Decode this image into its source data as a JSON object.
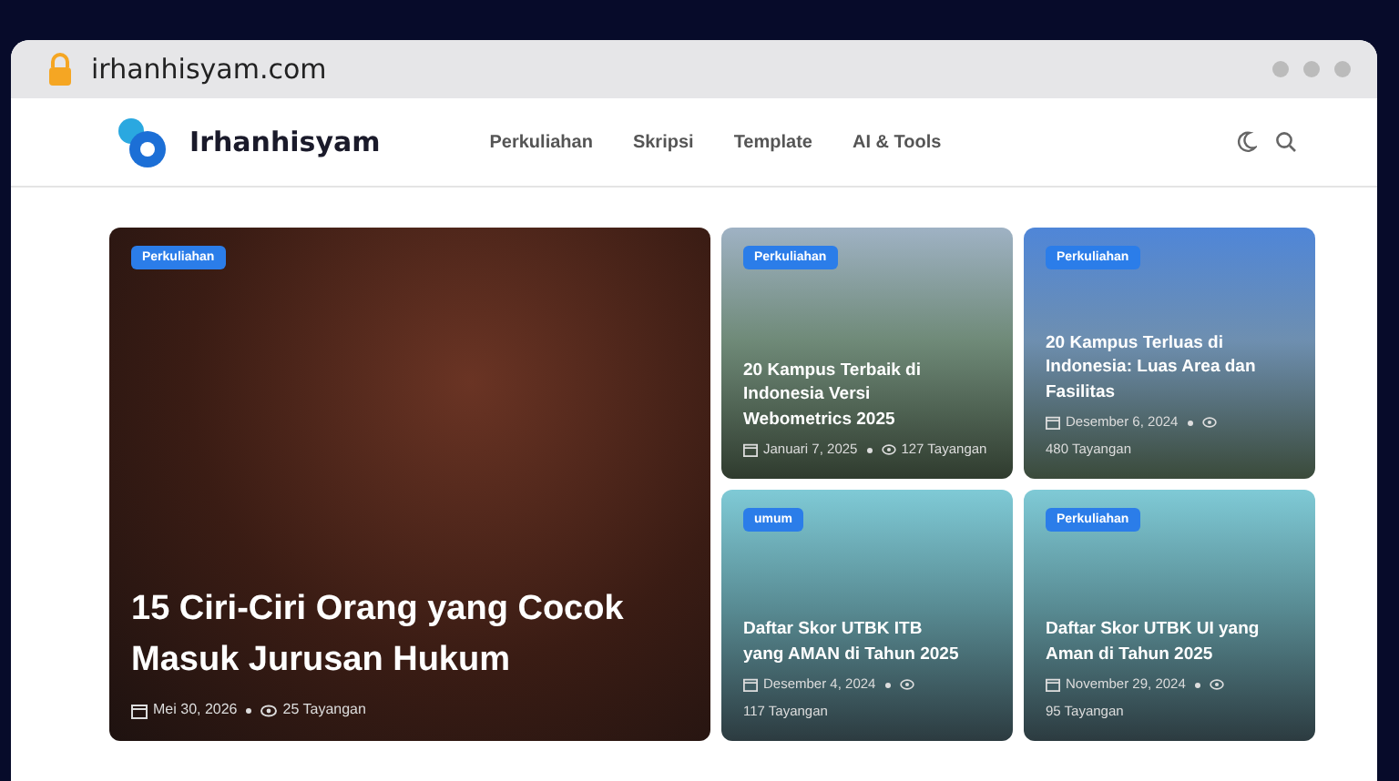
{
  "browser": {
    "url": "irhanhisyam.com"
  },
  "site": {
    "logo": "Irhanhisyam",
    "nav": [
      {
        "label": "Perkuliahan"
      },
      {
        "label": "Skripsi"
      },
      {
        "label": "Template"
      },
      {
        "label": "AI & Tools"
      }
    ]
  },
  "featured": {
    "category": "Perkuliahan",
    "title": "15 Ciri-Ciri Orang yang Cocok Masuk Jurusan Hukum",
    "date": "Mei 30, 2026",
    "views": "25 Tayangan"
  },
  "posts": [
    {
      "category": "Perkuliahan",
      "title": "20 Kampus Terbaik di Indonesia Versi Webometrics 2025",
      "date": "Januari 7, 2025",
      "views": "127 Tayangan",
      "kind": "campus"
    },
    {
      "category": "Perkuliahan",
      "title": "20 Kampus Terluas di Indonesia: Luas Area dan Fasilitas",
      "date": "Desember 6, 2024",
      "views": "480 Tayangan",
      "kind": "tower"
    },
    {
      "category": "umum",
      "title": "Daftar Skor UTBK ITB yang AMAN di Tahun 2025",
      "date": "Desember 4, 2024",
      "views": "117 Tayangan",
      "kind": "utbk"
    },
    {
      "category": "Perkuliahan",
      "title": "Daftar Skor UTBK UI yang Aman di Tahun 2025",
      "date": "November 29, 2024",
      "views": "95 Tayangan",
      "kind": "utbk"
    }
  ]
}
